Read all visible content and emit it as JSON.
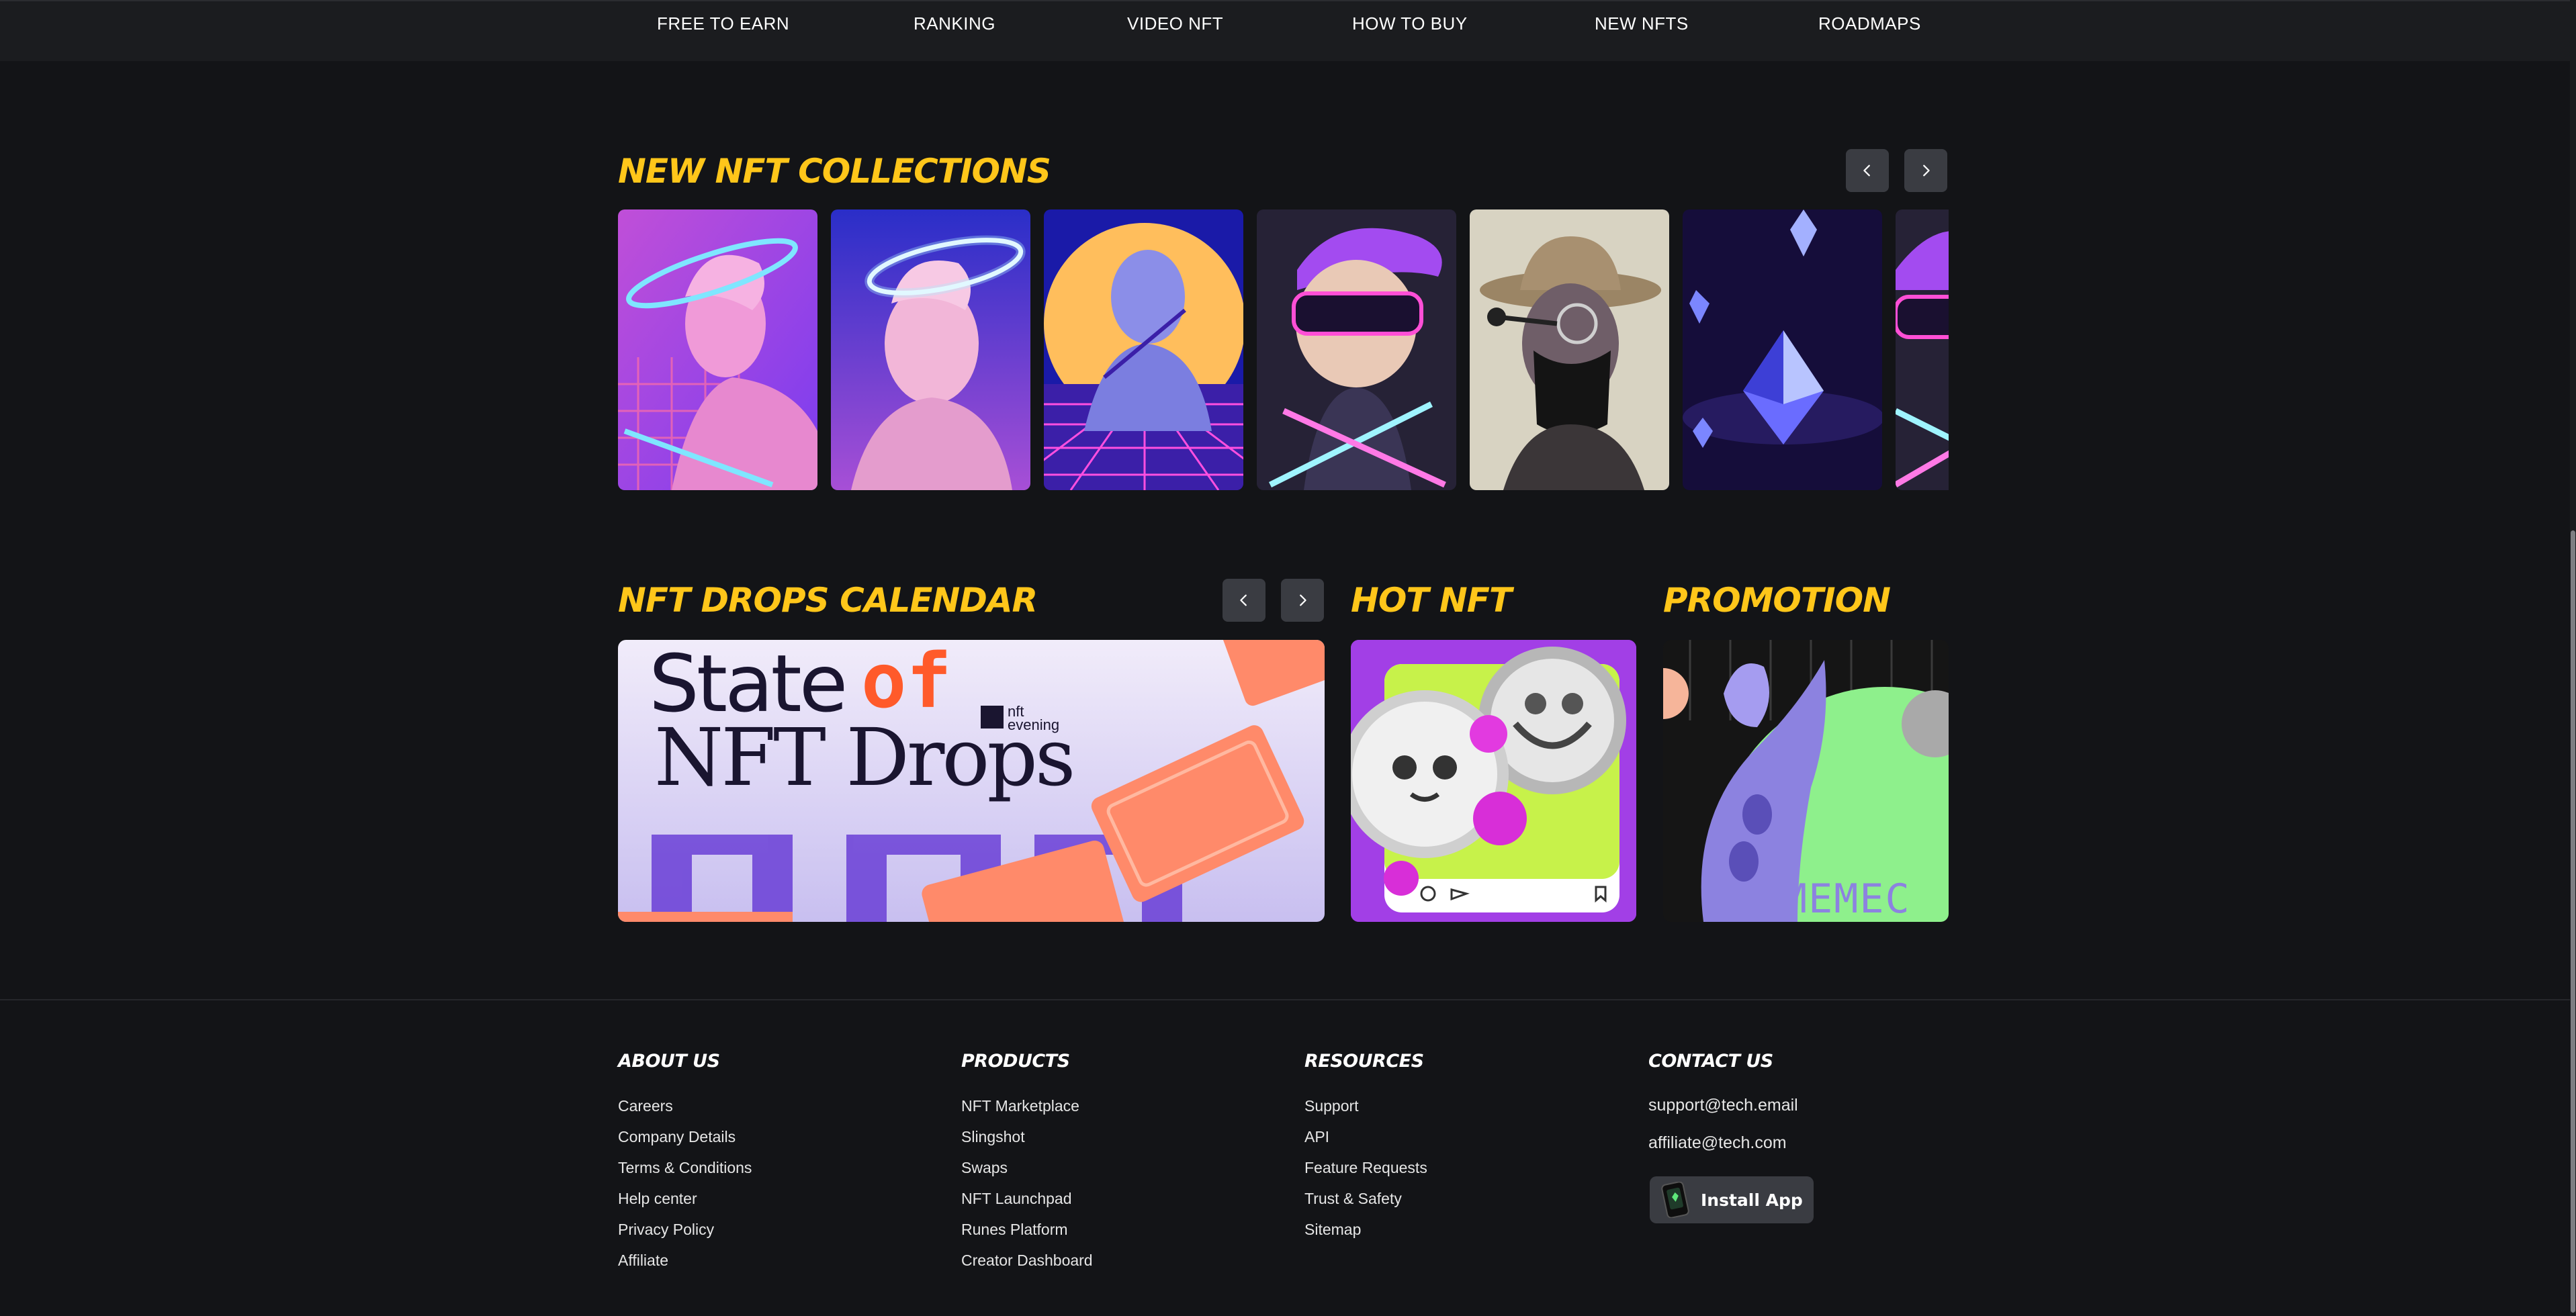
{
  "nav": {
    "items": [
      "FREE TO EARN",
      "RANKING",
      "VIDEO NFT",
      "HOW TO BUY",
      "NEW NFTS",
      "ROADMAPS"
    ]
  },
  "collections": {
    "title": "NEW NFT COLLECTIONS"
  },
  "drops": {
    "title": "NFT DROPS CALENDAR",
    "banner_line1": "State",
    "banner_of": "of",
    "banner_line2": "NFT Drops",
    "banner_brand_top": "nft",
    "banner_brand_bottom": "evening"
  },
  "hot": {
    "title": "HOT NFT"
  },
  "promotion": {
    "title": "PROMOTION",
    "banner_text": "MEMEC"
  },
  "footer": {
    "about": {
      "title": "ABOUT US",
      "links": [
        "Careers",
        "Company Details",
        "Terms & Conditions",
        "Help center",
        "Privacy Policy",
        "Affiliate"
      ]
    },
    "products": {
      "title": "PRODUCTS",
      "links": [
        "NFT Marketplace",
        "Slingshot",
        "Swaps",
        "NFT Launchpad",
        "Runes Platform",
        "Creator Dashboard"
      ]
    },
    "resources": {
      "title": "RESOURCES",
      "links": [
        "Support",
        "API",
        "Feature Requests",
        "Trust & Safety",
        "Sitemap"
      ]
    },
    "contact": {
      "title": "CONTACT US",
      "email_support": "support@tech.email",
      "email_affiliate": "affiliate@tech.com",
      "install_label": "Install App"
    }
  },
  "colors": {
    "background": "#131417",
    "accent": "#ffc61a",
    "button": "#3a3c42"
  }
}
